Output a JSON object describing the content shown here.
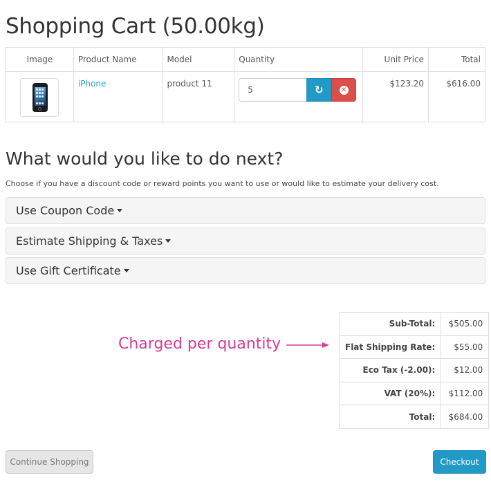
{
  "page": {
    "title": "Shopping Cart  (50.00kg)"
  },
  "cart": {
    "columns": {
      "image": "Image",
      "name": "Product Name",
      "model": "Model",
      "quantity": "Quantity",
      "unit_price": "Unit Price",
      "total": "Total"
    },
    "item": {
      "image": "iphone-thumbnail",
      "name": "iPhone",
      "model": "product 11",
      "quantity": "5",
      "unit_price": "$123.20",
      "total": "$616.00"
    },
    "update_icon": "refresh-icon",
    "remove_icon": "times-circle-icon"
  },
  "next": {
    "heading": "What would you like to do next?",
    "description": "Choose if you have a discount code or reward points you want to use or would like to estimate your delivery cost.",
    "panels": [
      "Use Coupon Code",
      "Estimate Shipping & Taxes",
      "Use Gift Certificate"
    ]
  },
  "annotation": {
    "text": "Charged per quantity",
    "color": "#d63c96"
  },
  "totals": [
    {
      "label": "Sub-Total:",
      "value": "$505.00"
    },
    {
      "label": "Flat Shipping Rate:",
      "value": "$55.00"
    },
    {
      "label": "Eco Tax (-2.00):",
      "value": "$12.00"
    },
    {
      "label": "VAT (20%):",
      "value": "$112.00"
    },
    {
      "label": "Total:",
      "value": "$684.00"
    }
  ],
  "actions": {
    "continue": "Continue Shopping",
    "checkout": "Checkout"
  },
  "colors": {
    "primary": "#229ac8",
    "danger": "#da4f49",
    "link": "#23a1d1"
  }
}
